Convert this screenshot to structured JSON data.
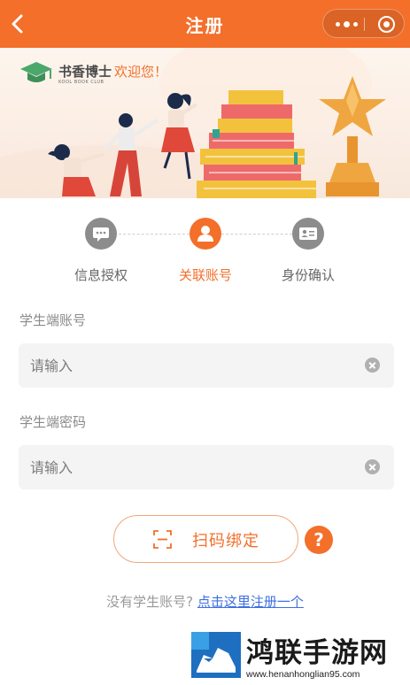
{
  "header": {
    "title": "注册",
    "back_icon": "chevron-left-icon",
    "menu_icon": "more-dots-icon",
    "close_icon": "target-circle-icon",
    "bg_color": "#f36f2a"
  },
  "banner": {
    "brand_name": "书香博士",
    "brand_sub": "KOOL BOOK CLUB",
    "welcome": "欢迎您！",
    "logo_icon": "graduation-cap-icon"
  },
  "steps": [
    {
      "label": "信息授权",
      "icon": "chat-bubble-icon",
      "active": false
    },
    {
      "label": "关联账号",
      "icon": "user-icon",
      "active": true
    },
    {
      "label": "身份确认",
      "icon": "id-card-icon",
      "active": false
    }
  ],
  "form": {
    "account_label": "学生端账号",
    "account_placeholder": "请输入",
    "password_label": "学生端密码",
    "password_placeholder": "请输入"
  },
  "scan_button": {
    "label": "扫码绑定",
    "icon": "scan-icon"
  },
  "help": {
    "label": "?"
  },
  "footer": {
    "question": "没有学生账号?",
    "link": "点击这里注册一个"
  },
  "watermark": {
    "title": "鸿联手游网",
    "url": "www.henanhonglian95.com"
  },
  "colors": {
    "accent": "#f36f2a",
    "link": "#3e6fe0",
    "inactive_step": "#8c8c8c"
  }
}
